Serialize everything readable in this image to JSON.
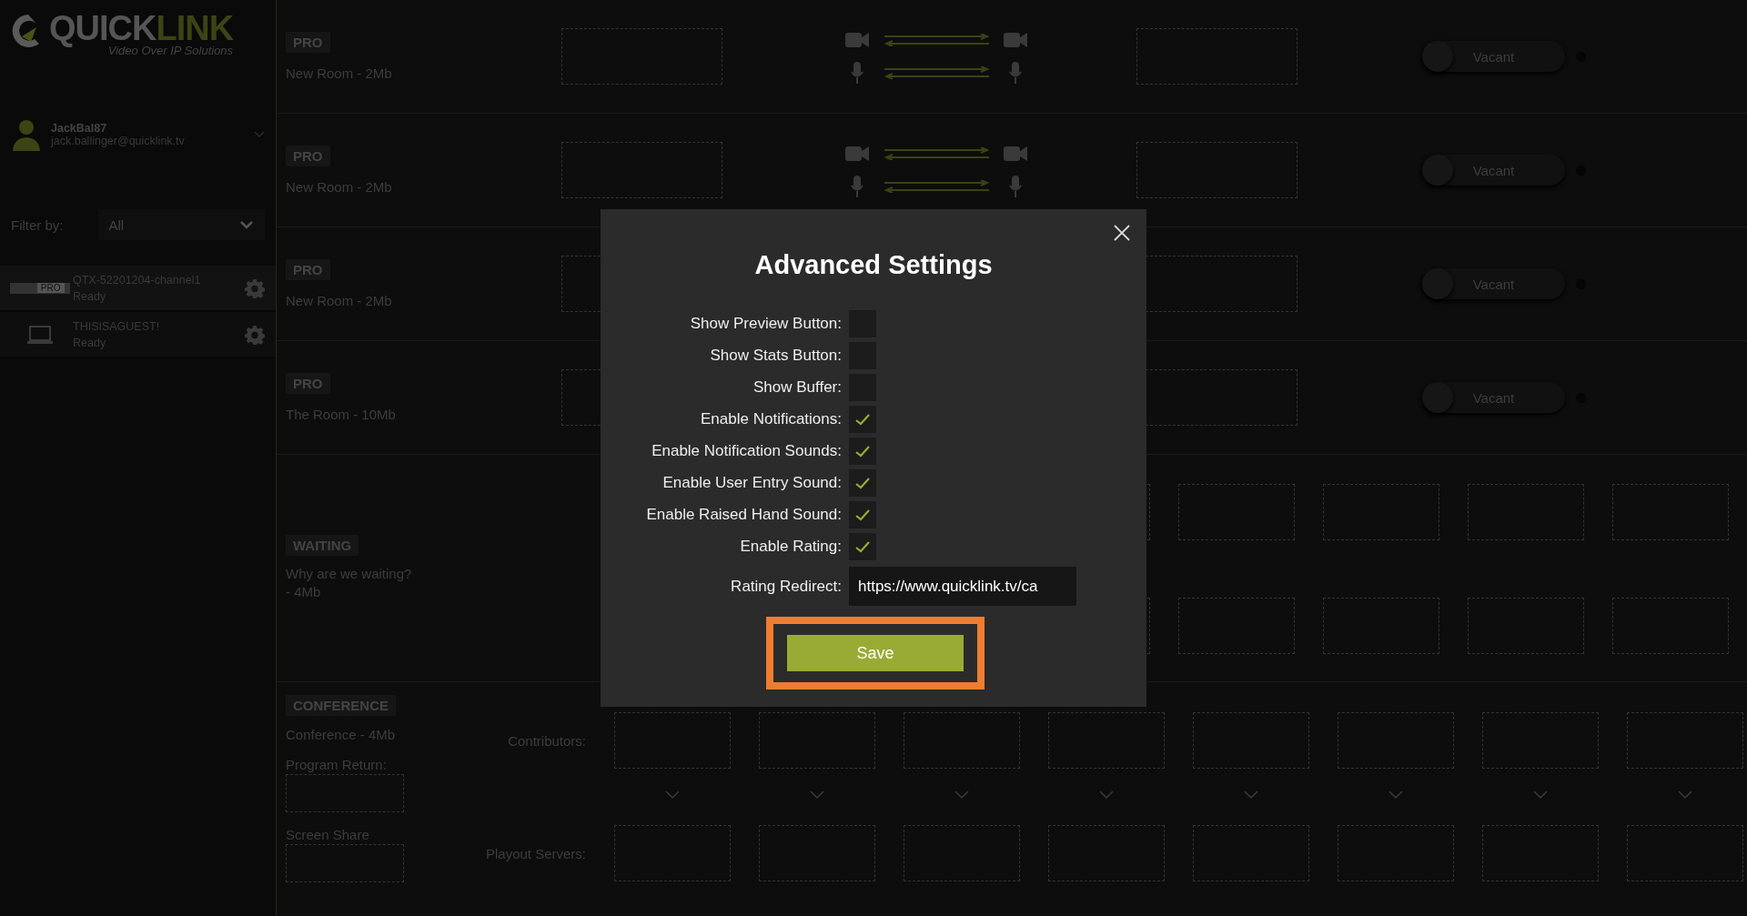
{
  "logo": {
    "word_1": "QUICK",
    "word_2": "LINK",
    "tagline": "Video Over IP Solutions"
  },
  "user": {
    "name": "JackBal87",
    "email": "jack.ballinger@quicklink.tv"
  },
  "filter": {
    "label": "Filter by:",
    "value": "All"
  },
  "devices": [
    {
      "kind": "rack",
      "badge": "PRO",
      "name": "QTX-52201204-channel1",
      "status": "Ready"
    },
    {
      "kind": "laptop",
      "name": "THISISAGUEST!",
      "status": "Ready"
    }
  ],
  "rooms": [
    {
      "tag": "PRO",
      "name": "New Room - 2Mb",
      "toggle": {
        "label": "Vacant",
        "on": false
      }
    },
    {
      "tag": "PRO",
      "name": "New Room - 2Mb",
      "toggle": {
        "label": "Vacant",
        "on": false
      }
    },
    {
      "tag": "PRO",
      "name": "New Room - 2Mb",
      "toggle": {
        "label": "Vacant",
        "on": false
      }
    },
    {
      "tag": "PRO",
      "name": "The Room - 10Mb",
      "toggle": {
        "label": "Vacant",
        "on": false
      }
    }
  ],
  "waiting": {
    "tag": "WAITING",
    "name": "Why are we waiting? - 4Mb"
  },
  "conference": {
    "tag": "CONFERENCE",
    "name": "Conference - 4Mb",
    "program_return": "Program Return:",
    "screen_share": "Screen Share",
    "contributors_label": "Contributors:",
    "playout_label": "Playout Servers:"
  },
  "modal": {
    "title": "Advanced Settings",
    "settings": [
      {
        "label": "Show Preview Button:",
        "checked": false
      },
      {
        "label": "Show Stats Button:",
        "checked": false
      },
      {
        "label": "Show Buffer:",
        "checked": false
      },
      {
        "label": "Enable Notifications:",
        "checked": true
      },
      {
        "label": "Enable Notification Sounds:",
        "checked": true
      },
      {
        "label": "Enable User Entry Sound:",
        "checked": true
      },
      {
        "label": "Enable Raised Hand Sound:",
        "checked": true
      },
      {
        "label": "Enable Rating:",
        "checked": true
      }
    ],
    "redirect": {
      "label": "Rating Redirect:",
      "value": "https://www.quicklink.tv/ca"
    },
    "save": "Save"
  }
}
